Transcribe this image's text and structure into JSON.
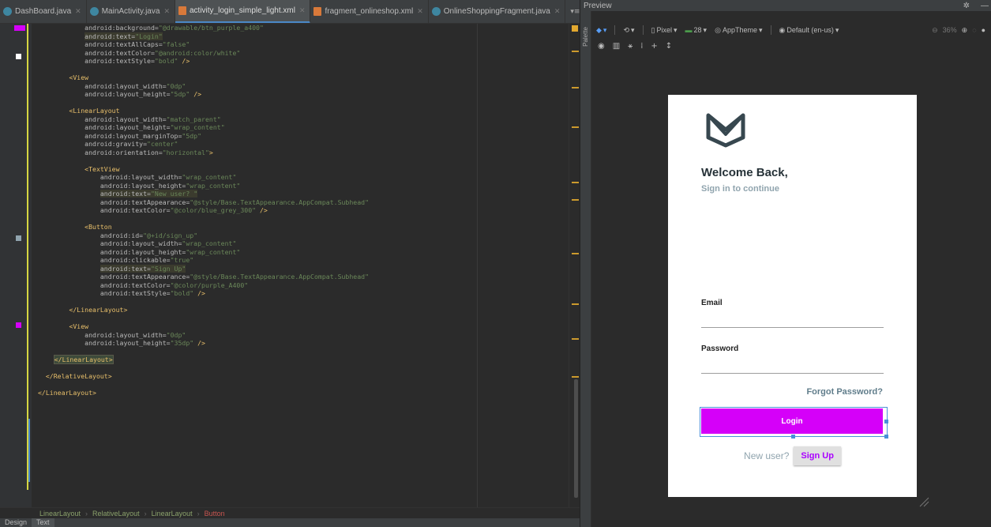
{
  "editor": {
    "tabs": [
      {
        "label": "DashBoard.java",
        "kind": "java"
      },
      {
        "label": "MainActivity.java",
        "kind": "java"
      },
      {
        "label": "activity_login_simple_light.xml",
        "kind": "xml"
      },
      {
        "label": "fragment_onlineshop.xml",
        "kind": "xml"
      },
      {
        "label": "OnlineShoppingFragment.java",
        "kind": "java"
      }
    ],
    "tab_menu": "▾≡₂",
    "code_lines": [
      [
        {
          "t": "            ",
          "c": ""
        },
        {
          "t": "android:background=",
          "c": "attr"
        },
        {
          "t": "\"@drawable/btn_purple_a400\"",
          "c": "val"
        }
      ],
      [
        {
          "t": "            ",
          "c": ""
        },
        {
          "t": "android:text=",
          "c": "attr hlbar"
        },
        {
          "t": "\"Login\"",
          "c": "val hlbar"
        }
      ],
      [
        {
          "t": "            ",
          "c": ""
        },
        {
          "t": "android:textAllCaps=",
          "c": "attr"
        },
        {
          "t": "\"false\"",
          "c": "val"
        }
      ],
      [
        {
          "t": "            ",
          "c": ""
        },
        {
          "t": "android:textColor=",
          "c": "attr"
        },
        {
          "t": "\"@android:color/white\"",
          "c": "val"
        }
      ],
      [
        {
          "t": "            ",
          "c": ""
        },
        {
          "t": "android:textStyle=",
          "c": "attr"
        },
        {
          "t": "\"bold\"",
          "c": "val"
        },
        {
          "t": " />",
          "c": "tag"
        }
      ],
      [
        {
          "t": "",
          "c": ""
        }
      ],
      [
        {
          "t": "        ",
          "c": ""
        },
        {
          "t": "<View",
          "c": "tag"
        }
      ],
      [
        {
          "t": "            ",
          "c": ""
        },
        {
          "t": "android:layout_width=",
          "c": "attr"
        },
        {
          "t": "\"0dp\"",
          "c": "val"
        }
      ],
      [
        {
          "t": "            ",
          "c": ""
        },
        {
          "t": "android:layout_height=",
          "c": "attr"
        },
        {
          "t": "\"5dp\"",
          "c": "val"
        },
        {
          "t": " />",
          "c": "tag"
        }
      ],
      [
        {
          "t": "",
          "c": ""
        }
      ],
      [
        {
          "t": "        ",
          "c": ""
        },
        {
          "t": "<LinearLayout",
          "c": "tag"
        }
      ],
      [
        {
          "t": "            ",
          "c": ""
        },
        {
          "t": "android:layout_width=",
          "c": "attr"
        },
        {
          "t": "\"match_parent\"",
          "c": "val"
        }
      ],
      [
        {
          "t": "            ",
          "c": ""
        },
        {
          "t": "android:layout_height=",
          "c": "attr"
        },
        {
          "t": "\"wrap_content\"",
          "c": "val"
        }
      ],
      [
        {
          "t": "            ",
          "c": ""
        },
        {
          "t": "android:layout_marginTop=",
          "c": "attr"
        },
        {
          "t": "\"5dp\"",
          "c": "val"
        }
      ],
      [
        {
          "t": "            ",
          "c": ""
        },
        {
          "t": "android:gravity=",
          "c": "attr"
        },
        {
          "t": "\"center\"",
          "c": "val"
        }
      ],
      [
        {
          "t": "            ",
          "c": ""
        },
        {
          "t": "android:orientation=",
          "c": "attr"
        },
        {
          "t": "\"horizontal\"",
          "c": "val"
        },
        {
          "t": ">",
          "c": "tag"
        }
      ],
      [
        {
          "t": "",
          "c": ""
        }
      ],
      [
        {
          "t": "            ",
          "c": ""
        },
        {
          "t": "<TextView",
          "c": "tag"
        }
      ],
      [
        {
          "t": "                ",
          "c": ""
        },
        {
          "t": "android:layout_width=",
          "c": "attr"
        },
        {
          "t": "\"wrap_content\"",
          "c": "val"
        }
      ],
      [
        {
          "t": "                ",
          "c": ""
        },
        {
          "t": "android:layout_height=",
          "c": "attr"
        },
        {
          "t": "\"wrap_content\"",
          "c": "val"
        }
      ],
      [
        {
          "t": "                ",
          "c": ""
        },
        {
          "t": "android:text=",
          "c": "attr hlbar"
        },
        {
          "t": "\"New user? \"",
          "c": "val hlbar"
        }
      ],
      [
        {
          "t": "                ",
          "c": ""
        },
        {
          "t": "android:textAppearance=",
          "c": "attr"
        },
        {
          "t": "\"@style/Base.TextAppearance.AppCompat.Subhead\"",
          "c": "val"
        }
      ],
      [
        {
          "t": "                ",
          "c": ""
        },
        {
          "t": "android:textColor=",
          "c": "attr"
        },
        {
          "t": "\"@color/blue_grey_300\"",
          "c": "val"
        },
        {
          "t": " />",
          "c": "tag"
        }
      ],
      [
        {
          "t": "",
          "c": ""
        }
      ],
      [
        {
          "t": "            ",
          "c": ""
        },
        {
          "t": "<Button",
          "c": "tag"
        }
      ],
      [
        {
          "t": "                ",
          "c": ""
        },
        {
          "t": "android:id=",
          "c": "attr"
        },
        {
          "t": "\"@+id/sign_up\"",
          "c": "val"
        }
      ],
      [
        {
          "t": "                ",
          "c": ""
        },
        {
          "t": "android:layout_width=",
          "c": "attr"
        },
        {
          "t": "\"wrap_content\"",
          "c": "val"
        }
      ],
      [
        {
          "t": "                ",
          "c": ""
        },
        {
          "t": "android:layout_height=",
          "c": "attr"
        },
        {
          "t": "\"wrap_content\"",
          "c": "val"
        }
      ],
      [
        {
          "t": "                ",
          "c": ""
        },
        {
          "t": "android:clickable=",
          "c": "attr"
        },
        {
          "t": "\"true\"",
          "c": "val"
        }
      ],
      [
        {
          "t": "                ",
          "c": ""
        },
        {
          "t": "android:text=",
          "c": "attr hlbar"
        },
        {
          "t": "\"Sign Up\"",
          "c": "val hlbar"
        }
      ],
      [
        {
          "t": "                ",
          "c": ""
        },
        {
          "t": "android:textAppearance=",
          "c": "attr"
        },
        {
          "t": "\"@style/Base.TextAppearance.AppCompat.Subhead\"",
          "c": "val"
        }
      ],
      [
        {
          "t": "                ",
          "c": ""
        },
        {
          "t": "android:textColor=",
          "c": "attr"
        },
        {
          "t": "\"@color/purple_A400\"",
          "c": "val"
        }
      ],
      [
        {
          "t": "                ",
          "c": ""
        },
        {
          "t": "android:textStyle=",
          "c": "attr"
        },
        {
          "t": "\"bold\"",
          "c": "val"
        },
        {
          "t": " />",
          "c": "tag"
        }
      ],
      [
        {
          "t": "",
          "c": ""
        }
      ],
      [
        {
          "t": "        ",
          "c": ""
        },
        {
          "t": "</LinearLayout>",
          "c": "tag"
        }
      ],
      [
        {
          "t": "",
          "c": ""
        }
      ],
      [
        {
          "t": "        ",
          "c": ""
        },
        {
          "t": "<View",
          "c": "tag"
        }
      ],
      [
        {
          "t": "            ",
          "c": ""
        },
        {
          "t": "android:layout_width=",
          "c": "attr"
        },
        {
          "t": "\"0dp\"",
          "c": "val"
        }
      ],
      [
        {
          "t": "            ",
          "c": ""
        },
        {
          "t": "android:layout_height=",
          "c": "attr"
        },
        {
          "t": "\"35dp\"",
          "c": "val"
        },
        {
          "t": " />",
          "c": "tag"
        }
      ],
      [
        {
          "t": "",
          "c": ""
        }
      ],
      [
        {
          "t": "    ",
          "c": ""
        },
        {
          "t": "</LinearLayout>",
          "c": "tag hlbox"
        }
      ],
      [
        {
          "t": "",
          "c": ""
        }
      ],
      [
        {
          "t": "  ",
          "c": ""
        },
        {
          "t": "</RelativeLayout>",
          "c": "tag"
        }
      ],
      [
        {
          "t": "",
          "c": ""
        }
      ],
      [
        {
          "t": "",
          "c": ""
        },
        {
          "t": "</LinearLayout>",
          "c": "tag"
        }
      ]
    ],
    "breadcrumb": [
      "LinearLayout",
      "RelativeLayout",
      "LinearLayout",
      "Button"
    ],
    "mode_tabs": [
      "Design",
      "Text"
    ]
  },
  "preview": {
    "title": "Preview",
    "palette_label": "Palette",
    "toolbar": {
      "device": "Pixel",
      "api": "28",
      "theme": "AppTheme",
      "locale": "Default (en-us)",
      "zoom": "36%"
    }
  },
  "phone": {
    "welcome": "Welcome Back,",
    "subtitle": "Sign in to continue",
    "email_label": "Email",
    "password_label": "Password",
    "forgot": "Forgot Password?",
    "login": "Login",
    "new_user": "New user?",
    "sign_up": "Sign Up"
  },
  "colors": {
    "accent": "#d500f9",
    "sign_up_text": "#aa00ff",
    "blue_grey": "#90a4ae"
  }
}
